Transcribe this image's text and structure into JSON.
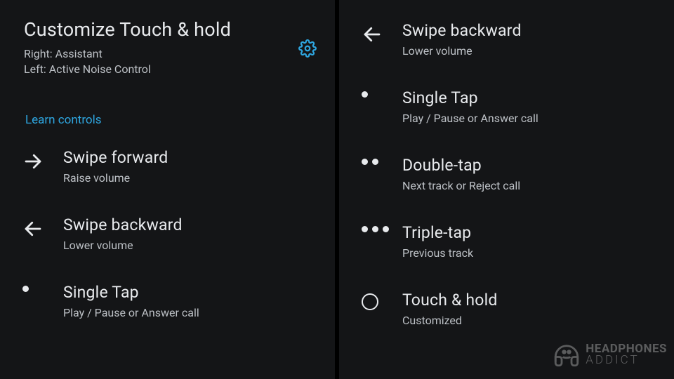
{
  "left": {
    "title": "Customize Touch & hold",
    "subtitle_line1": "Right: Assistant",
    "subtitle_line2": "Left: Active Noise Control",
    "learn_link": "Learn controls",
    "items": [
      {
        "icon": "arrow-right",
        "title": "Swipe forward",
        "desc": "Raise volume"
      },
      {
        "icon": "arrow-left",
        "title": "Swipe backward",
        "desc": "Lower volume"
      },
      {
        "icon": "dot-1",
        "title": "Single Tap",
        "desc": "Play / Pause or Answer call"
      }
    ]
  },
  "right": {
    "items": [
      {
        "icon": "arrow-left",
        "title": "Swipe backward",
        "desc": "Lower volume"
      },
      {
        "icon": "dot-1",
        "title": "Single Tap",
        "desc": "Play / Pause or Answer call"
      },
      {
        "icon": "dot-2",
        "title": "Double-tap",
        "desc": "Next track or Reject call"
      },
      {
        "icon": "dot-3",
        "title": "Triple-tap",
        "desc": "Previous track"
      },
      {
        "icon": "circle",
        "title": "Touch & hold",
        "desc": "Customized"
      }
    ]
  },
  "watermark": {
    "top": "HEADPHONES",
    "bottom": "ADDICT"
  }
}
